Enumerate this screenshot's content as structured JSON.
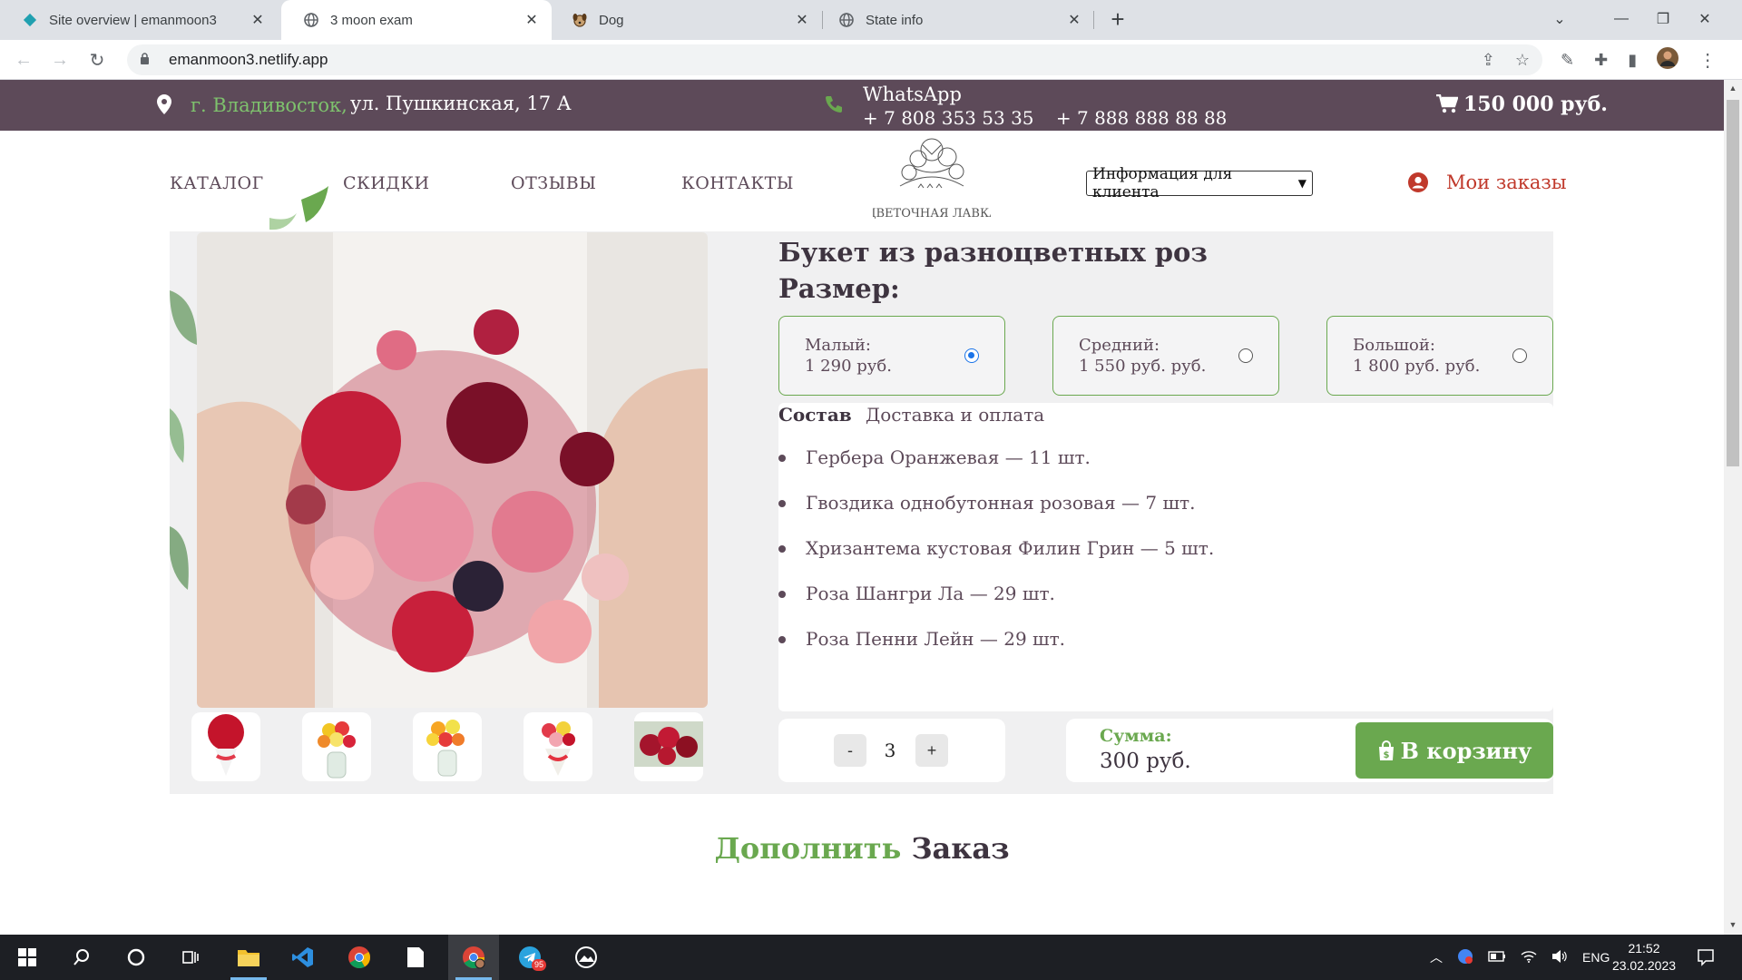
{
  "browser": {
    "tabs": [
      {
        "title": "Site overview | emanmoon3",
        "icon": "netlify-icon"
      },
      {
        "title": "3 moon exam",
        "icon": "globe-icon"
      },
      {
        "title": "Dog",
        "icon": "dog-icon"
      },
      {
        "title": "State info",
        "icon": "globe-icon"
      }
    ],
    "url": "emanmoon3.netlify.app"
  },
  "site": {
    "city": "г. Владивосток,",
    "street": "ул. Пушкинская, 17 А",
    "whatsapp_label": "WhatsApp",
    "phones": [
      "+ 7 808 353 53 35",
      "+ 7 888 888 88 88"
    ],
    "cart_total": "150 000 руб.",
    "nav": [
      "КАТАЛОГ",
      "СКИДКИ",
      "ОТЗЫВЫ",
      "КОНТАКТЫ"
    ],
    "client_info": "Информация для клиента",
    "my_orders": "Мои заказы",
    "logo_text": "ЦВЕТОЧНАЯ ЛАВКА"
  },
  "product": {
    "title": "Букет из разноцветных роз",
    "size_label": "Размер:",
    "sizes": [
      {
        "name": "Малый:",
        "price": "1 290 руб.",
        "selected": true
      },
      {
        "name": "Средний:",
        "price": "1 550 руб. руб.",
        "selected": false
      },
      {
        "name": "Большой:",
        "price": "1 800 руб. руб.",
        "selected": false
      }
    ],
    "tabs": [
      "Состав",
      "Доставка и оплата"
    ],
    "composition": [
      "Гербера Оранжевая — 11 шт.",
      "Гвоздика однобутонная розовая — 7 шт.",
      "Хризантема кустовая Филин Грин — 5 шт.",
      "Роза Шангри Ла — 29 шт.",
      "Роза Пенни Лейн — 29 шт."
    ],
    "qty_minus": "-",
    "qty_value": "3",
    "qty_plus": "+",
    "sum_label": "Сумма:",
    "sum_value": "300 руб.",
    "add_to_cart": "В корзину"
  },
  "addon": {
    "green": "Дополнить",
    "dark": "Заказ"
  },
  "taskbar": {
    "lang": "ENG",
    "time": "21:52",
    "date": "23.02.2023",
    "telegram_badge": "95"
  },
  "colors": {
    "brand_purple": "#5d4a59",
    "brand_green": "#6aa84f",
    "accent_red": "#c0392b"
  }
}
